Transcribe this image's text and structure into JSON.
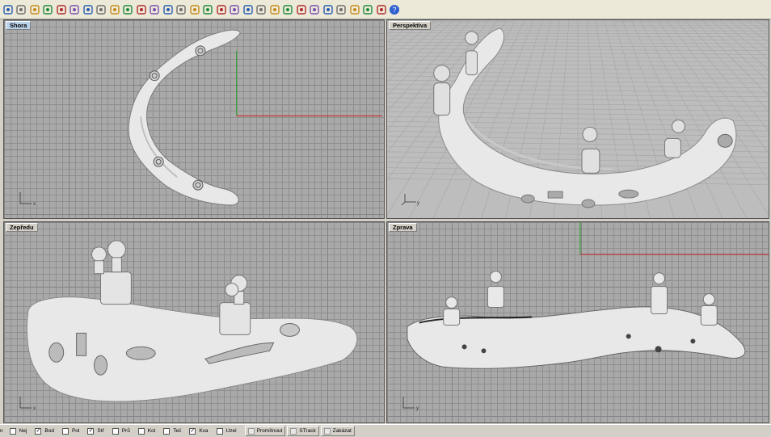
{
  "toolbar": {
    "icons": [
      "new-file-icon",
      "open-icon",
      "save-icon",
      "print-icon",
      "import-icon",
      "cut-icon",
      "copy-icon",
      "paste-icon",
      "undo-icon",
      "pan-icon",
      "rotate-icon",
      "zoom-icon",
      "zoom-window-icon",
      "zoom-extents-icon",
      "zoom-selected-icon",
      "four-viewports-icon",
      "car-icon",
      "lasso-icon",
      "dimension-icon",
      "layer-icon",
      "light-icon",
      "lock-icon",
      "render-icon",
      "color-wheel-icon",
      "shade-icon",
      "render-sphere-icon",
      "pointer-icon",
      "settings-icon",
      "filter-icon",
      "help-icon"
    ],
    "help_glyph": "?"
  },
  "viewports": {
    "top": {
      "title": "Shora"
    },
    "perspective": {
      "title": "Perspektiva"
    },
    "front": {
      "title": "Zepředu"
    },
    "right": {
      "title": "Zprava"
    }
  },
  "axes": {
    "x": "x",
    "y": "y"
  },
  "statusbar": {
    "lead": "n",
    "osnaps": [
      {
        "label": "Nej",
        "checked": false
      },
      {
        "label": "Bod",
        "checked": true
      },
      {
        "label": "Pol",
        "checked": false
      },
      {
        "label": "Stř",
        "checked": true
      },
      {
        "label": "Prů",
        "checked": false
      },
      {
        "label": "Kol",
        "checked": false
      },
      {
        "label": "Teč",
        "checked": false
      },
      {
        "label": "Kva",
        "checked": true
      },
      {
        "label": "Uzel",
        "checked": false
      }
    ],
    "buttons": [
      "Promítnout",
      "STrack",
      "Zakázat"
    ],
    "check_glyph": "✓"
  },
  "colors": {
    "model": "#e8e8e8",
    "model_shadow": "#8a8a8a",
    "axis_red": "#d02020",
    "axis_green": "#20a020",
    "title_active": "#b9d1ea"
  }
}
